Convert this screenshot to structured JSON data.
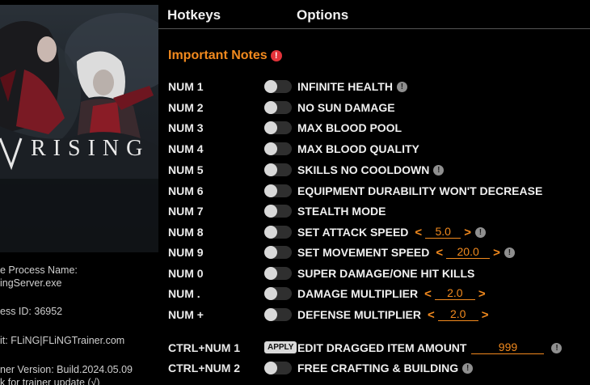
{
  "left_panel": {
    "game_title": "RISING",
    "process_name_label": "e Process Name:",
    "process_name_value": "ingServer.exe",
    "process_id": "ess ID: 36952",
    "credit": "it: FLiNG|FLiNGTrainer.com",
    "trainer_version": "ner Version: Build.2024.05.09",
    "update_check": "k for trainer update (√)"
  },
  "tabs": {
    "hotkeys": "Hotkeys",
    "options": "Options"
  },
  "notes": {
    "label": "Important Notes",
    "icon": "alert-icon"
  },
  "colors": {
    "accent": "#f28a1e",
    "alert": "#e2333a",
    "background": "#000000"
  },
  "rows": [
    {
      "hotkey": "NUM 1",
      "label": "INFINITE HEALTH",
      "info": "!"
    },
    {
      "hotkey": "NUM 2",
      "label": "NO SUN DAMAGE"
    },
    {
      "hotkey": "NUM 3",
      "label": "MAX BLOOD POOL"
    },
    {
      "hotkey": "NUM 4",
      "label": "MAX BLOOD QUALITY"
    },
    {
      "hotkey": "NUM 5",
      "label": "SKILLS NO COOLDOWN",
      "info": "!"
    },
    {
      "hotkey": "NUM 6",
      "label": "EQUIPMENT DURABILITY WON'T DECREASE"
    },
    {
      "hotkey": "NUM 7",
      "label": "STEALTH MODE"
    },
    {
      "hotkey": "NUM 8",
      "label": "SET ATTACK SPEED",
      "value": "5.0",
      "info": "!"
    },
    {
      "hotkey": "NUM 9",
      "label": "SET MOVEMENT SPEED",
      "value": "20.0",
      "info": "!"
    },
    {
      "hotkey": "NUM 0",
      "label": "SUPER DAMAGE/ONE HIT KILLS"
    },
    {
      "hotkey": "NUM .",
      "label": "DAMAGE MULTIPLIER",
      "value": "2.0"
    },
    {
      "hotkey": "NUM +",
      "label": "DEFENSE MULTIPLIER",
      "value": "2.0"
    },
    {
      "hotkey": "CTRL+NUM 1",
      "label": "EDIT DRAGGED ITEM AMOUNT",
      "value": "999",
      "info": "!",
      "apply": "APPLY"
    },
    {
      "hotkey": "CTRL+NUM 2",
      "label": "FREE CRAFTING & BUILDING",
      "info": "!"
    }
  ]
}
